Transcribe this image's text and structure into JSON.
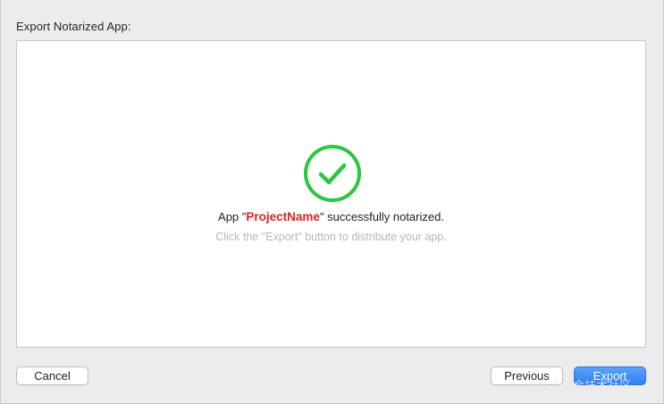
{
  "header": {
    "title": "Export Notarized App:"
  },
  "status": {
    "message_prefix": "App \"",
    "project_name": "ProjectName",
    "message_suffix": "\" successfully notarized.",
    "hint": "Click the \"Export\" button to distribute your app.",
    "icon": "checkmark-circle-icon",
    "icon_color": "#28c840",
    "project_name_color": "#e0231c"
  },
  "buttons": {
    "cancel": "Cancel",
    "previous": "Previous",
    "export": "Export"
  },
  "colors": {
    "accent": "#3a8af5"
  },
  "watermark": "@稀土掘金技术社区"
}
